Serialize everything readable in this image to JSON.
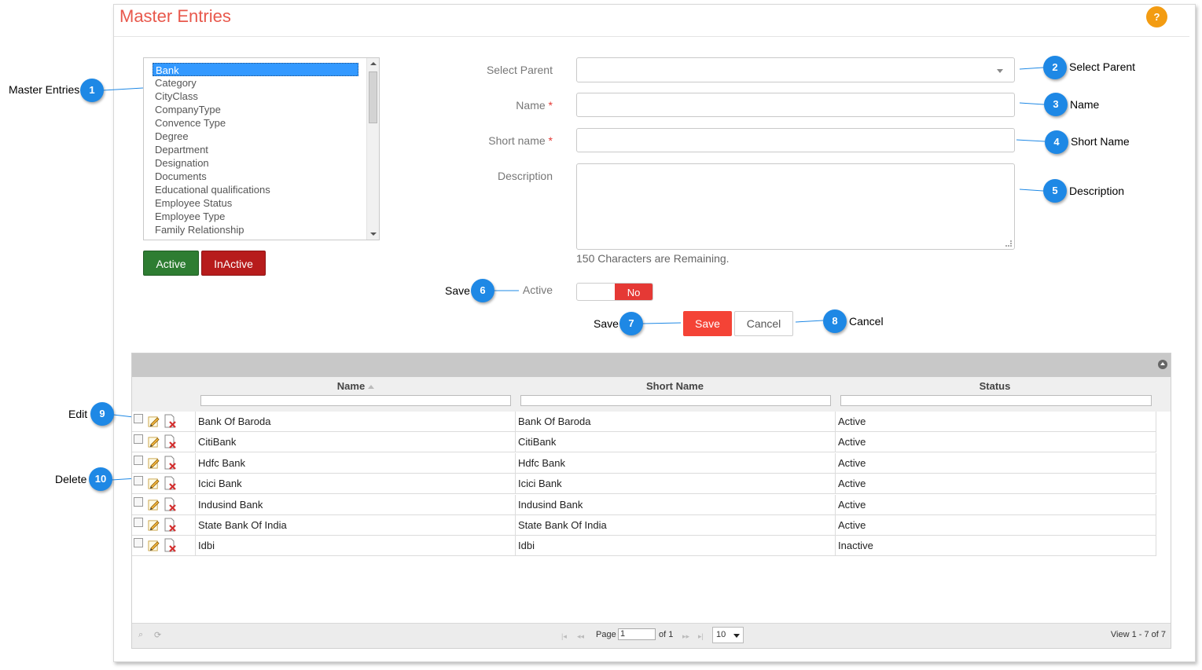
{
  "page": {
    "title": "Master Entries",
    "help_label": "?"
  },
  "master_list": {
    "items": [
      "Bank",
      "Category",
      "CityClass",
      "CompanyType",
      "Convence Type",
      "Degree",
      "Department",
      "Designation",
      "Documents",
      "Educational qualifications",
      "Employee Status",
      "Employee Type",
      "Family Relationship"
    ],
    "selected": "Bank"
  },
  "list_buttons": {
    "active": "Active",
    "inactive": "InActive"
  },
  "form": {
    "select_parent_label": "Select Parent",
    "name_label": "Name",
    "short_name_label": "Short name",
    "description_label": "Description",
    "required_mark": "*",
    "remaining_text": "150 Characters are Remaining.",
    "active_label": "Active",
    "toggle_value": "No",
    "save_label": "Save",
    "cancel_label": "Cancel"
  },
  "callouts": [
    {
      "num": "1",
      "text": "Master Entries"
    },
    {
      "num": "2",
      "text": "Select Parent"
    },
    {
      "num": "3",
      "text": "Name"
    },
    {
      "num": "4",
      "text": "Short Name"
    },
    {
      "num": "5",
      "text": "Description"
    },
    {
      "num": "6",
      "text": "Save"
    },
    {
      "num": "7",
      "text": "Save"
    },
    {
      "num": "8",
      "text": "Cancel"
    },
    {
      "num": "9",
      "text": "Edit"
    },
    {
      "num": "10",
      "text": "Delete"
    }
  ],
  "grid": {
    "columns": [
      "Name",
      "Short Name",
      "Status"
    ],
    "rows": [
      {
        "name": "Bank Of Baroda",
        "short": "Bank Of Baroda",
        "status": "Active"
      },
      {
        "name": "CitiBank",
        "short": "CitiBank",
        "status": "Active"
      },
      {
        "name": "Hdfc Bank",
        "short": "Hdfc Bank",
        "status": "Active"
      },
      {
        "name": "Icici Bank",
        "short": "Icici Bank",
        "status": "Active"
      },
      {
        "name": "Indusind Bank",
        "short": "Indusind Bank",
        "status": "Active"
      },
      {
        "name": "State Bank Of India",
        "short": "State Bank Of India",
        "status": "Active"
      },
      {
        "name": "Idbi",
        "short": "Idbi",
        "status": "Inactive"
      }
    ],
    "pager": {
      "page_label": "Page",
      "page_value": "1",
      "of_label": "of 1",
      "rows_per_page": "10",
      "view_text": "View 1 - 7 of 7"
    }
  },
  "colors": {
    "title": "#e8584c",
    "callout": "#1e88e5",
    "active_btn": "#2e7d32",
    "inactive_btn": "#b71c1c",
    "save_btn": "#f44336",
    "help": "#f39c12"
  }
}
